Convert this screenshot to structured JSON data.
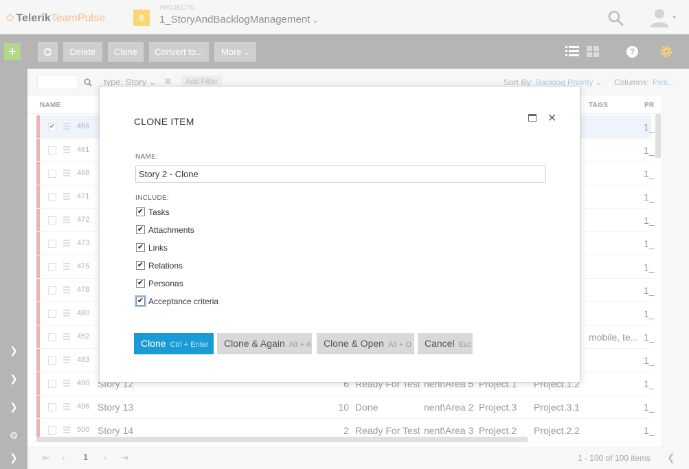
{
  "header": {
    "logo_mark": "✩",
    "logo_brand": "Telerik",
    "logo_product": "TeamPulse",
    "project_count": "8",
    "projects_caption": "PROJECTS:",
    "project_name": "1_StoryAndBacklogManagement"
  },
  "toolbar": {
    "add_label": "+",
    "delete_label": "Delete",
    "clone_label": "Clone",
    "convert_label": "Convert to...",
    "more_label": "More"
  },
  "filter": {
    "chip": "type: Story",
    "add_filter": "Add Filter",
    "sort_label": "Sort By:",
    "sort_value": "Backlog Priority",
    "columns_label": "Columns:",
    "columns_value": "Pick..."
  },
  "grid": {
    "headers": {
      "name": "NAME",
      "tags": "TAGS",
      "project": "PR"
    },
    "rows": [
      {
        "id": "456",
        "name": "",
        "priority": "",
        "status": "",
        "area": "",
        "iteration": "",
        "subiteration": "",
        "tags": "",
        "project": "1_",
        "checked": true,
        "selected": true
      },
      {
        "id": "461",
        "name": "",
        "priority": "",
        "status": "",
        "area": "",
        "iteration": "",
        "subiteration": "",
        "tags": "",
        "project": "1_"
      },
      {
        "id": "468",
        "name": "",
        "priority": "",
        "status": "",
        "area": "",
        "iteration": "",
        "subiteration": "",
        "tags": "",
        "project": "1_"
      },
      {
        "id": "471",
        "name": "",
        "priority": "",
        "status": "",
        "area": "",
        "iteration": "",
        "subiteration": "",
        "tags": "",
        "project": "1_"
      },
      {
        "id": "472",
        "name": "",
        "priority": "",
        "status": "",
        "area": "",
        "iteration": "",
        "subiteration": "",
        "tags": "",
        "project": "1_"
      },
      {
        "id": "473",
        "name": "",
        "priority": "",
        "status": "",
        "area": "",
        "iteration": "",
        "subiteration": "",
        "tags": "",
        "project": "1_"
      },
      {
        "id": "475",
        "name": "",
        "priority": "",
        "status": "",
        "area": "",
        "iteration": "",
        "subiteration": "",
        "tags": "",
        "project": "1_"
      },
      {
        "id": "478",
        "name": "",
        "priority": "",
        "status": "",
        "area": "",
        "iteration": "",
        "subiteration": "",
        "tags": "",
        "project": "1_"
      },
      {
        "id": "480",
        "name": "",
        "priority": "",
        "status": "",
        "area": "",
        "iteration": "",
        "subiteration": "",
        "tags": "",
        "project": "1_"
      },
      {
        "id": "452",
        "name": "",
        "priority": "",
        "status": "",
        "area": "",
        "iteration": "",
        "subiteration": "",
        "tags": "mobile, te...",
        "project": "1_"
      },
      {
        "id": "483",
        "name": "",
        "priority": "",
        "status": "",
        "area": "",
        "iteration": "",
        "subiteration": "",
        "tags": "",
        "project": "1_"
      },
      {
        "id": "490",
        "name": "Story 12",
        "priority": "6",
        "status": "Ready For Test",
        "area": "nent\\Area 5",
        "iteration": "Project.1",
        "subiteration": "Project.1.2",
        "tags": "",
        "project": "1_"
      },
      {
        "id": "496",
        "name": "Story 13",
        "priority": "10",
        "status": "Done",
        "area": "nent\\Area 2",
        "iteration": "Project.3",
        "subiteration": "Project.3.1",
        "tags": "",
        "project": "1_"
      },
      {
        "id": "500",
        "name": "Story 14",
        "priority": "2",
        "status": "Ready For Test",
        "area": "nent\\Area 3",
        "iteration": "Project.2",
        "subiteration": "Project.2.2",
        "tags": "",
        "project": "1_"
      }
    ]
  },
  "pager": {
    "first": "⇤",
    "prev": "‹",
    "page": "1",
    "next": "›",
    "last": "⇥",
    "info": "1 - 100 of 100 items"
  },
  "dialog": {
    "title": "CLONE ITEM",
    "name_label": "NAME:",
    "name_value": "Story 2 - Clone",
    "include_label": "INCLUDE:",
    "options": [
      {
        "label": "Tasks",
        "checked": true
      },
      {
        "label": "Attachments",
        "checked": true
      },
      {
        "label": "Links",
        "checked": true
      },
      {
        "label": "Relations",
        "checked": true
      },
      {
        "label": "Personas",
        "checked": true
      },
      {
        "label": "Acceptance criteria",
        "checked": true,
        "focused": true
      }
    ],
    "buttons": {
      "clone": "Clone",
      "clone_key": "Ctrl + Enter",
      "again": "Clone & Again",
      "again_key": "Alt + A",
      "open": "Clone & Open",
      "open_key": "Alt + O",
      "cancel": "Cancel",
      "cancel_key": "Esc"
    }
  },
  "colors": {
    "accent_blue": "#1a9bd7",
    "toolbar_gray": "#8e8e8e",
    "row_accent": "#e08a8a",
    "add_green": "#8bc34a",
    "project_badge": "#f9c02a"
  }
}
